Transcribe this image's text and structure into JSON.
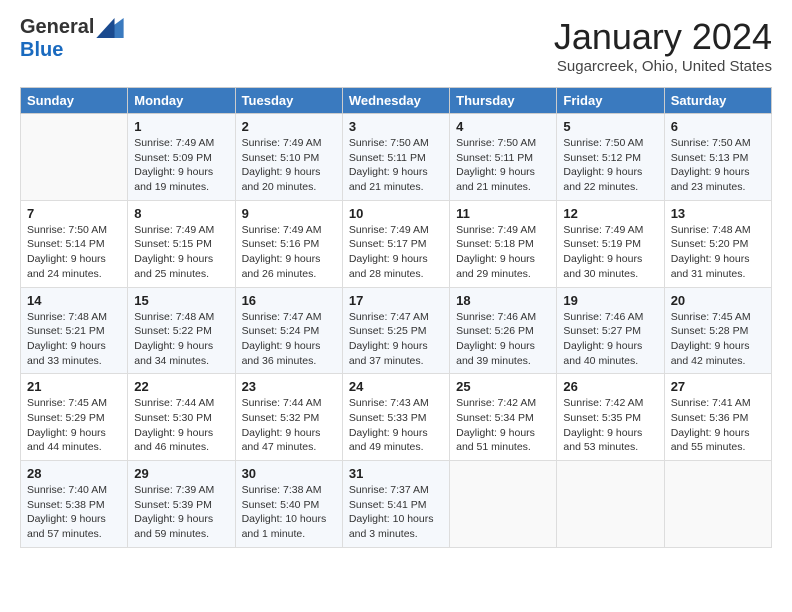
{
  "header": {
    "logo_general": "General",
    "logo_blue": "Blue",
    "month_title": "January 2024",
    "location": "Sugarcreek, Ohio, United States"
  },
  "weekdays": [
    "Sunday",
    "Monday",
    "Tuesday",
    "Wednesday",
    "Thursday",
    "Friday",
    "Saturday"
  ],
  "weeks": [
    [
      {
        "day": "",
        "sunrise": "",
        "sunset": "",
        "daylight": ""
      },
      {
        "day": "1",
        "sunrise": "Sunrise: 7:49 AM",
        "sunset": "Sunset: 5:09 PM",
        "daylight": "Daylight: 9 hours and 19 minutes."
      },
      {
        "day": "2",
        "sunrise": "Sunrise: 7:49 AM",
        "sunset": "Sunset: 5:10 PM",
        "daylight": "Daylight: 9 hours and 20 minutes."
      },
      {
        "day": "3",
        "sunrise": "Sunrise: 7:50 AM",
        "sunset": "Sunset: 5:11 PM",
        "daylight": "Daylight: 9 hours and 21 minutes."
      },
      {
        "day": "4",
        "sunrise": "Sunrise: 7:50 AM",
        "sunset": "Sunset: 5:11 PM",
        "daylight": "Daylight: 9 hours and 21 minutes."
      },
      {
        "day": "5",
        "sunrise": "Sunrise: 7:50 AM",
        "sunset": "Sunset: 5:12 PM",
        "daylight": "Daylight: 9 hours and 22 minutes."
      },
      {
        "day": "6",
        "sunrise": "Sunrise: 7:50 AM",
        "sunset": "Sunset: 5:13 PM",
        "daylight": "Daylight: 9 hours and 23 minutes."
      }
    ],
    [
      {
        "day": "7",
        "sunrise": "Sunrise: 7:50 AM",
        "sunset": "Sunset: 5:14 PM",
        "daylight": "Daylight: 9 hours and 24 minutes."
      },
      {
        "day": "8",
        "sunrise": "Sunrise: 7:49 AM",
        "sunset": "Sunset: 5:15 PM",
        "daylight": "Daylight: 9 hours and 25 minutes."
      },
      {
        "day": "9",
        "sunrise": "Sunrise: 7:49 AM",
        "sunset": "Sunset: 5:16 PM",
        "daylight": "Daylight: 9 hours and 26 minutes."
      },
      {
        "day": "10",
        "sunrise": "Sunrise: 7:49 AM",
        "sunset": "Sunset: 5:17 PM",
        "daylight": "Daylight: 9 hours and 28 minutes."
      },
      {
        "day": "11",
        "sunrise": "Sunrise: 7:49 AM",
        "sunset": "Sunset: 5:18 PM",
        "daylight": "Daylight: 9 hours and 29 minutes."
      },
      {
        "day": "12",
        "sunrise": "Sunrise: 7:49 AM",
        "sunset": "Sunset: 5:19 PM",
        "daylight": "Daylight: 9 hours and 30 minutes."
      },
      {
        "day": "13",
        "sunrise": "Sunrise: 7:48 AM",
        "sunset": "Sunset: 5:20 PM",
        "daylight": "Daylight: 9 hours and 31 minutes."
      }
    ],
    [
      {
        "day": "14",
        "sunrise": "Sunrise: 7:48 AM",
        "sunset": "Sunset: 5:21 PM",
        "daylight": "Daylight: 9 hours and 33 minutes."
      },
      {
        "day": "15",
        "sunrise": "Sunrise: 7:48 AM",
        "sunset": "Sunset: 5:22 PM",
        "daylight": "Daylight: 9 hours and 34 minutes."
      },
      {
        "day": "16",
        "sunrise": "Sunrise: 7:47 AM",
        "sunset": "Sunset: 5:24 PM",
        "daylight": "Daylight: 9 hours and 36 minutes."
      },
      {
        "day": "17",
        "sunrise": "Sunrise: 7:47 AM",
        "sunset": "Sunset: 5:25 PM",
        "daylight": "Daylight: 9 hours and 37 minutes."
      },
      {
        "day": "18",
        "sunrise": "Sunrise: 7:46 AM",
        "sunset": "Sunset: 5:26 PM",
        "daylight": "Daylight: 9 hours and 39 minutes."
      },
      {
        "day": "19",
        "sunrise": "Sunrise: 7:46 AM",
        "sunset": "Sunset: 5:27 PM",
        "daylight": "Daylight: 9 hours and 40 minutes."
      },
      {
        "day": "20",
        "sunrise": "Sunrise: 7:45 AM",
        "sunset": "Sunset: 5:28 PM",
        "daylight": "Daylight: 9 hours and 42 minutes."
      }
    ],
    [
      {
        "day": "21",
        "sunrise": "Sunrise: 7:45 AM",
        "sunset": "Sunset: 5:29 PM",
        "daylight": "Daylight: 9 hours and 44 minutes."
      },
      {
        "day": "22",
        "sunrise": "Sunrise: 7:44 AM",
        "sunset": "Sunset: 5:30 PM",
        "daylight": "Daylight: 9 hours and 46 minutes."
      },
      {
        "day": "23",
        "sunrise": "Sunrise: 7:44 AM",
        "sunset": "Sunset: 5:32 PM",
        "daylight": "Daylight: 9 hours and 47 minutes."
      },
      {
        "day": "24",
        "sunrise": "Sunrise: 7:43 AM",
        "sunset": "Sunset: 5:33 PM",
        "daylight": "Daylight: 9 hours and 49 minutes."
      },
      {
        "day": "25",
        "sunrise": "Sunrise: 7:42 AM",
        "sunset": "Sunset: 5:34 PM",
        "daylight": "Daylight: 9 hours and 51 minutes."
      },
      {
        "day": "26",
        "sunrise": "Sunrise: 7:42 AM",
        "sunset": "Sunset: 5:35 PM",
        "daylight": "Daylight: 9 hours and 53 minutes."
      },
      {
        "day": "27",
        "sunrise": "Sunrise: 7:41 AM",
        "sunset": "Sunset: 5:36 PM",
        "daylight": "Daylight: 9 hours and 55 minutes."
      }
    ],
    [
      {
        "day": "28",
        "sunrise": "Sunrise: 7:40 AM",
        "sunset": "Sunset: 5:38 PM",
        "daylight": "Daylight: 9 hours and 57 minutes."
      },
      {
        "day": "29",
        "sunrise": "Sunrise: 7:39 AM",
        "sunset": "Sunset: 5:39 PM",
        "daylight": "Daylight: 9 hours and 59 minutes."
      },
      {
        "day": "30",
        "sunrise": "Sunrise: 7:38 AM",
        "sunset": "Sunset: 5:40 PM",
        "daylight": "Daylight: 10 hours and 1 minute."
      },
      {
        "day": "31",
        "sunrise": "Sunrise: 7:37 AM",
        "sunset": "Sunset: 5:41 PM",
        "daylight": "Daylight: 10 hours and 3 minutes."
      },
      {
        "day": "",
        "sunrise": "",
        "sunset": "",
        "daylight": ""
      },
      {
        "day": "",
        "sunrise": "",
        "sunset": "",
        "daylight": ""
      },
      {
        "day": "",
        "sunrise": "",
        "sunset": "",
        "daylight": ""
      }
    ]
  ]
}
